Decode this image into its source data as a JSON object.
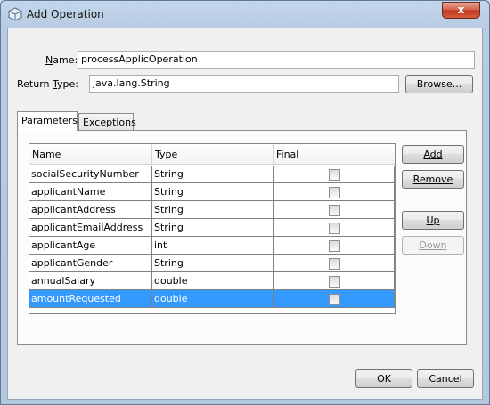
{
  "window": {
    "title": "Add Operation",
    "close_glyph": "x"
  },
  "form": {
    "name_label_mnemonic": "N",
    "name_label_rest": "ame:",
    "name_value": "processApplicOperation",
    "return_label_pre": "Return ",
    "return_label_mnemonic": "T",
    "return_label_rest": "ype:",
    "return_value": "java.lang.String",
    "browse_label": "Browse..."
  },
  "tabs": [
    {
      "label": "Parameters",
      "active": true
    },
    {
      "label": "Exceptions",
      "active": false
    }
  ],
  "table": {
    "columns": [
      "Name",
      "Type",
      "Final"
    ],
    "rows": [
      {
        "name": "socialSecurityNumber",
        "type": "String",
        "final": false
      },
      {
        "name": "applicantName",
        "type": "String",
        "final": false
      },
      {
        "name": "applicantAddress",
        "type": "String",
        "final": false
      },
      {
        "name": "applicantEmailAddress",
        "type": "String",
        "final": false
      },
      {
        "name": "applicantAge",
        "type": "int",
        "final": false
      },
      {
        "name": "applicantGender",
        "type": "String",
        "final": false
      },
      {
        "name": "annualSalary",
        "type": "double",
        "final": false
      },
      {
        "name": "amountRequested",
        "type": "double",
        "final": false,
        "selected": true
      }
    ]
  },
  "side_buttons": {
    "add": "Add",
    "remove": "Remove",
    "up": "Up",
    "down": "Down"
  },
  "footer": {
    "ok": "OK",
    "cancel": "Cancel"
  },
  "colors": {
    "selection": "#3399ff",
    "titlebar": "#b9cde3",
    "close": "#c7442a"
  }
}
